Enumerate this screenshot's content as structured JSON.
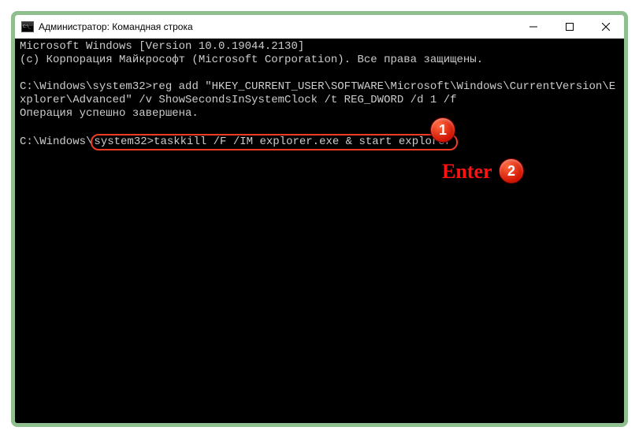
{
  "window": {
    "title": "Администратор: Командная строка"
  },
  "terminal": {
    "line1": "Microsoft Windows [Version 10.0.19044.2130]",
    "line2": "(c) Корпорация Майкрософт (Microsoft Corporation). Все права защищены.",
    "blank1": "",
    "prompt1_prefix": "C:\\Windows\\system32>",
    "cmd1": "reg add \"HKEY_CURRENT_USER\\SOFTWARE\\Microsoft\\Windows\\CurrentVersion\\Explorer\\Advanced\" /v ShowSecondsInSystemClock /t REG_DWORD /d 1 /f",
    "result1": "Операция успешно завершена.",
    "blank2": "",
    "prompt2_prefix": "C:\\Windows\\",
    "prompt2_inside": "system32>",
    "cmd2": "taskkill /F /IM explorer.exe & start explorer"
  },
  "annotations": {
    "badge1": "1",
    "badge2": "2",
    "enter_label": "Enter"
  }
}
